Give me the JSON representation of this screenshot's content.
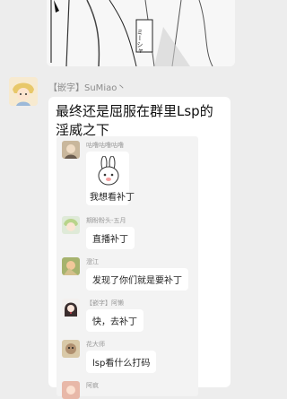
{
  "header_message": {
    "manga_text": "ミーシャ"
  },
  "main_message": {
    "sender": "【嵌字】SuMiao丶",
    "text": "最终还是屈服在群里Lsp的淫威之下"
  },
  "forwarded": [
    {
      "name": "咕噜咕噜咕噜",
      "text": "我想看补丁",
      "sticker": "bunny-sticker"
    },
    {
      "name": "期盼粉头-五月",
      "text": "直播补丁"
    },
    {
      "name": "澄江",
      "text": "发现了你们就是要补丁"
    },
    {
      "name": "【嵌字】阿懒",
      "text": "快，去补丁"
    },
    {
      "name": "花大师",
      "text": "lsp看什么打码"
    },
    {
      "name": "阿疯",
      "text": ""
    }
  ],
  "colors": {
    "background": "#ededed",
    "bubble": "#ffffff",
    "panel": "#f3f3f3"
  }
}
